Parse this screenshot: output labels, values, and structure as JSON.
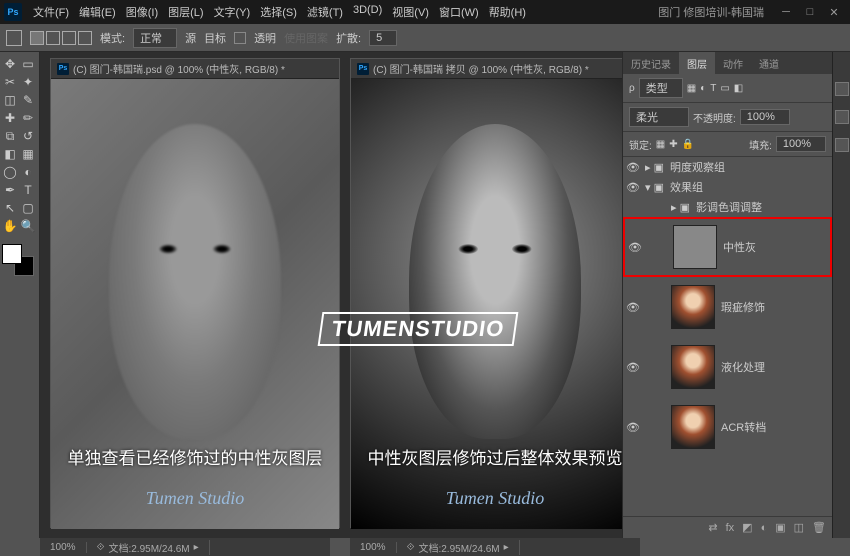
{
  "menus": [
    "文件(F)",
    "编辑(E)",
    "图像(I)",
    "图层(L)",
    "文字(Y)",
    "选择(S)",
    "滤镜(T)",
    "3D(D)",
    "视图(V)",
    "窗口(W)",
    "帮助(H)"
  ],
  "title_right": "图门 修图培训-韩国瑞",
  "optbar": {
    "mode_label": "模式:",
    "mode_value": "正常",
    "source": "源",
    "target": "目标",
    "transparent": "透明",
    "use_image": "使用图案",
    "diffusion_label": "扩散:",
    "diffusion_value": "5"
  },
  "doc1": {
    "title": "(C) 图门-韩国瑞.psd @ 100% (中性灰, RGB/8) *"
  },
  "doc2": {
    "title": "(C) 图门-韩国瑞 拷贝 @ 100% (中性灰, RGB/8) *"
  },
  "caption1": "单独查看已经修饰过的中性灰图层",
  "caption2": "中性灰图层修饰过后整体效果预览",
  "studio_text": "Tumen Studio",
  "watermark": "TUMENSTUDIO",
  "panel_tabs": [
    "历史记录",
    "图层",
    "动作",
    "通道"
  ],
  "layer_ctrl": {
    "kind_label": "类型",
    "blend": "柔光",
    "opacity_label": "不透明度:",
    "opacity_val": "100%",
    "lock_label": "锁定:",
    "fill_label": "填充:",
    "fill_val": "100%"
  },
  "layers": {
    "group1": "明度观察组",
    "group2": "效果组",
    "adj": "影调色调调整",
    "neutral": "中性灰",
    "blemish": "瑕疵修饰",
    "liquify": "液化处理",
    "acr": "ACR转档"
  },
  "status": {
    "zoom": "100%",
    "info": "文档:2.95M/24.6M"
  }
}
